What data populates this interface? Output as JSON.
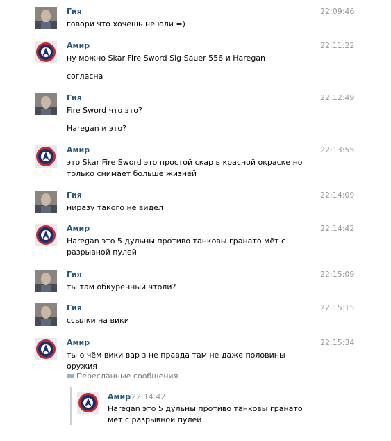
{
  "messages": [
    {
      "author": "Гия",
      "time": "22:09:46",
      "avatar": "photo-avatar",
      "lines": [
        "говори что хочешь не юли =)"
      ]
    },
    {
      "author": "Амир",
      "time": "22:11:22",
      "avatar": "emblem-avatar",
      "lines": [
        "ну можно Skar Fire Sword Sig Sauer 556 и Haregan",
        "согласна"
      ]
    },
    {
      "author": "Гия",
      "time": "22:12:49",
      "avatar": "photo-avatar",
      "lines": [
        "Fire Sword что это?",
        "Haregan и это?"
      ]
    },
    {
      "author": "Амир",
      "time": "22:13:55",
      "avatar": "emblem-avatar",
      "lines": [
        "это Skar Fire Sword это простой скар в красной окраске но только снимает больше жизней"
      ]
    },
    {
      "author": "Гия",
      "time": "22:14:09",
      "avatar": "photo-avatar",
      "lines": [
        "ниразу такого не видел"
      ]
    },
    {
      "author": "Амир",
      "time": "22:14:42",
      "avatar": "emblem-avatar",
      "lines": [
        "Haregan это 5 дульны противо танковы гранато мёт с разрывной пулей"
      ]
    },
    {
      "author": "Гия",
      "time": "22:15:09",
      "avatar": "photo-avatar",
      "lines": [
        "ты там обкуренный чтоли?"
      ]
    },
    {
      "author": "Гия",
      "time": "22:15:15",
      "avatar": "photo-avatar",
      "lines": [
        "ссылки на вики"
      ]
    },
    {
      "author": "Амир",
      "time": "22:15:34",
      "avatar": "emblem-avatar",
      "lines": [
        "ты о чём вики вар з не правда там не даже половины оружия"
      ]
    }
  ],
  "forwarded": {
    "header": "Пересланные сообщения",
    "author": "Амир",
    "time": "22:14:42",
    "avatar": "emblem-avatar",
    "text": "Haregan это 5 дульны противо танковы гранато мёт с разрывной пулей"
  },
  "colors": {
    "author_link": "#2B587A",
    "timestamp": "#999999",
    "forward_bar": "#C5D1DE",
    "forward_header": "#777777"
  }
}
